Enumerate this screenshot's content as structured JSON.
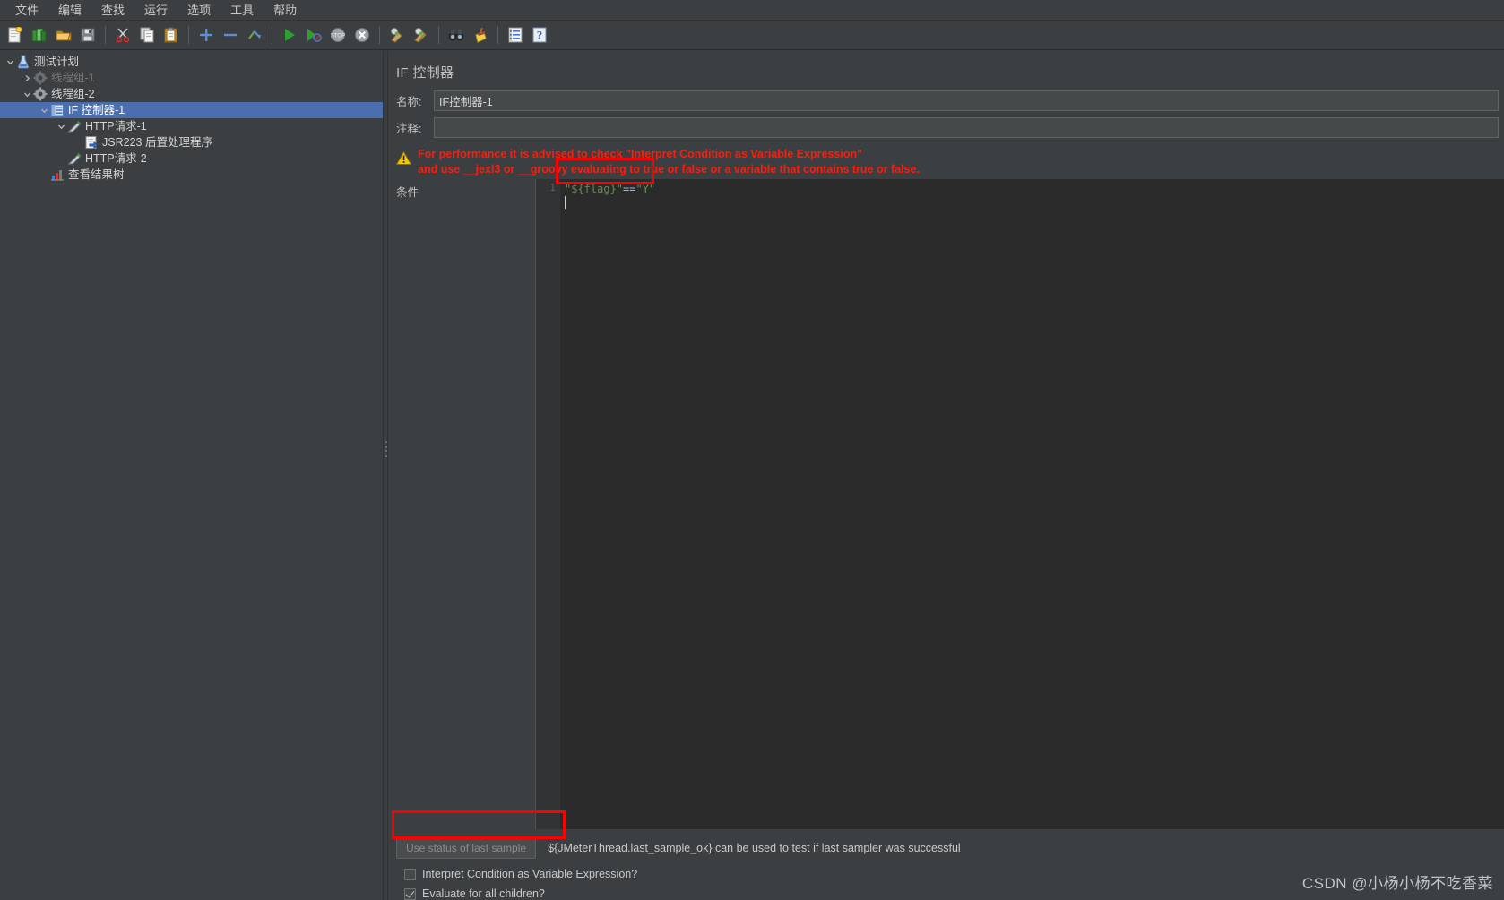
{
  "app": {
    "watermark": "CSDN @小杨小杨不吃香菜"
  },
  "menubar": {
    "items": [
      {
        "label": "文件",
        "name": "menu-file"
      },
      {
        "label": "编辑",
        "name": "menu-edit"
      },
      {
        "label": "查找",
        "name": "menu-search"
      },
      {
        "label": "运行",
        "name": "menu-run"
      },
      {
        "label": "选项",
        "name": "menu-options"
      },
      {
        "label": "工具",
        "name": "menu-tools"
      },
      {
        "label": "帮助",
        "name": "menu-help"
      }
    ]
  },
  "toolbar": {
    "buttons": [
      {
        "icon": "new-file-icon"
      },
      {
        "icon": "open-templates-icon"
      },
      {
        "icon": "open-folder-icon"
      },
      {
        "icon": "save-icon"
      },
      {
        "sep": true
      },
      {
        "icon": "cut-scissors-icon"
      },
      {
        "icon": "copy-icon"
      },
      {
        "icon": "paste-clipboard-icon"
      },
      {
        "sep": true
      },
      {
        "icon": "expand-plus-icon"
      },
      {
        "icon": "collapse-minus-icon"
      },
      {
        "icon": "toggle-enable-icon"
      },
      {
        "sep": true
      },
      {
        "icon": "start-play-icon"
      },
      {
        "icon": "start-no-pauses-icon"
      },
      {
        "icon": "stop-icon"
      },
      {
        "icon": "shutdown-icon"
      },
      {
        "sep": true
      },
      {
        "icon": "clear-icon"
      },
      {
        "icon": "clear-all-icon"
      },
      {
        "sep": true
      },
      {
        "icon": "search-binoculars-icon"
      },
      {
        "icon": "reset-search-broom-icon"
      },
      {
        "sep": true
      },
      {
        "icon": "function-helper-icon"
      },
      {
        "icon": "help-question-icon"
      }
    ]
  },
  "tree": {
    "nodes": [
      {
        "label": "测试计划",
        "indent": 0,
        "twisty": "down",
        "icon": "test-plan-icon",
        "selected": false,
        "disabled": false,
        "name": "tree-node-test-plan"
      },
      {
        "label": "线程组-1",
        "indent": 1,
        "twisty": "right",
        "icon": "thread-group-icon",
        "selected": false,
        "disabled": true,
        "name": "tree-node-thread-group-1"
      },
      {
        "label": "线程组-2",
        "indent": 1,
        "twisty": "down",
        "icon": "thread-group-icon",
        "selected": false,
        "disabled": false,
        "name": "tree-node-thread-group-2"
      },
      {
        "label": "IF 控制器-1",
        "indent": 2,
        "twisty": "down",
        "icon": "if-controller-icon",
        "selected": true,
        "disabled": false,
        "name": "tree-node-if-controller-1"
      },
      {
        "label": "HTTP请求-1",
        "indent": 3,
        "twisty": "down",
        "icon": "http-sampler-icon",
        "selected": false,
        "disabled": false,
        "name": "tree-node-http-request-1"
      },
      {
        "label": "JSR223 后置处理程序",
        "indent": 4,
        "twisty": "none",
        "icon": "post-processor-icon",
        "selected": false,
        "disabled": false,
        "name": "tree-node-jsr223-post-processor"
      },
      {
        "label": "HTTP请求-2",
        "indent": 3,
        "twisty": "none",
        "icon": "http-sampler-icon",
        "selected": false,
        "disabled": false,
        "name": "tree-node-http-request-2"
      },
      {
        "label": "查看结果树",
        "indent": 2,
        "twisty": "none",
        "icon": "view-results-tree-icon",
        "selected": false,
        "disabled": false,
        "name": "tree-node-view-results-tree"
      }
    ]
  },
  "panel": {
    "title": "IF 控制器",
    "name_label": "名称:",
    "name_value": "IF控制器-1",
    "comment_label": "注释:",
    "comment_value": "",
    "warning_line1": "For performance it is advised to check \"Interpret Condition as Variable Expression\"",
    "warning_line2": "and use __jexl3 or __groovy evaluating to true or false or a variable that contains true or false.",
    "condition_label": "条件",
    "gutter_line_number": "1",
    "condition_code": "\"${flag}\"==\"Y\"",
    "use_status_button": "Use status of last sample",
    "hint_text": "${JMeterThread.last_sample_ok} can be used to test if last sampler was successful",
    "checkbox_interpret_label": "Interpret Condition as Variable Expression?",
    "checkbox_interpret_checked": false,
    "checkbox_evaluate_label": "Evaluate for all children?",
    "checkbox_evaluate_checked": true
  },
  "colors": {
    "highlight": "#ff0000",
    "warning_text": "#fa1e0e",
    "selection": "#4b6eaf",
    "code_string": "#6a8759",
    "window_bg": "#3c3f41",
    "editor_bg": "#2b2b2b"
  }
}
